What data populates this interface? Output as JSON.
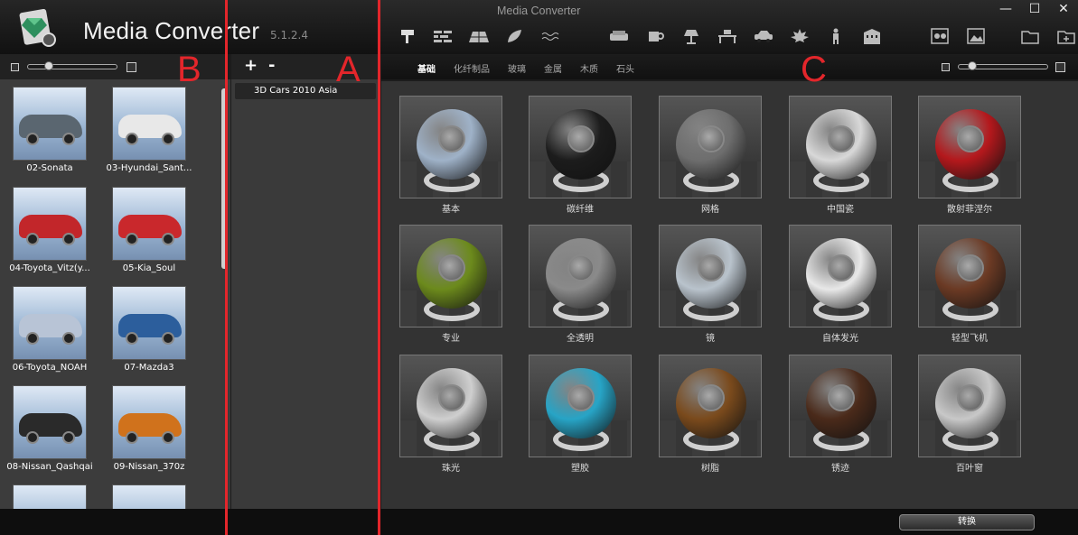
{
  "app": {
    "title": "Media Converter",
    "version": "5.1.2.4",
    "window_title": "Media Converter"
  },
  "window_controls": [
    "—",
    "☐",
    "✕"
  ],
  "annotations": {
    "a": "A",
    "b": "B",
    "c": "C",
    "color": "#e3262b"
  },
  "toolbar": {
    "icons": [
      "paint-roller-icon",
      "bricks-icon",
      "roof-tiles-icon",
      "leaf-icon",
      "water-icon",
      "sofa-icon",
      "cup-icon",
      "lamp-icon",
      "desk-icon",
      "car-icon",
      "maple-leaf-icon",
      "person-icon",
      "building-icon",
      "material-ball-icon",
      "image-icon",
      "folder-icon",
      "add-folder-icon"
    ]
  },
  "panel_a": {
    "add_label": "+",
    "remove_label": "-",
    "libraries": [
      "3D Cars 2010 Asia"
    ]
  },
  "panel_b": {
    "models": [
      {
        "name": "02-Sonata",
        "color": "#5a6670"
      },
      {
        "name": "03-Hyundai_Sant...",
        "color": "#e8e8e8"
      },
      {
        "name": "04-Toyota_Vitz(y...",
        "color": "#c2262a"
      },
      {
        "name": "05-Kia_Soul",
        "color": "#c9282c"
      },
      {
        "name": "06-Toyota_NOAH",
        "color": "#b8c4d6"
      },
      {
        "name": "07-Mazda3",
        "color": "#2c5e9c"
      },
      {
        "name": "08-Nissan_Qashqai",
        "color": "#2a2a2a"
      },
      {
        "name": "09-Nissan_370z",
        "color": "#d0721c"
      },
      {
        "name": "",
        "color": "#9ab5d3"
      },
      {
        "name": "",
        "color": "#9ab5d3"
      }
    ]
  },
  "panel_c": {
    "tabs": [
      "基础",
      "化纤制品",
      "玻璃",
      "金属",
      "木质",
      "石头"
    ],
    "active_tab": 0,
    "materials": [
      {
        "name": "基本",
        "color": "#9fb2c8"
      },
      {
        "name": "碳纤维",
        "color": "#1c1c1c"
      },
      {
        "name": "网格",
        "color": "#6e6e6e"
      },
      {
        "name": "中国瓷",
        "color": "#d8d8d8"
      },
      {
        "name": "散射菲涅尔",
        "color": "#b4181c"
      },
      {
        "name": "专业",
        "color": "#6c8a1c"
      },
      {
        "name": "全透明",
        "color": "#8a8a8a"
      },
      {
        "name": "镜",
        "color": "#b9c3cc"
      },
      {
        "name": "自体发光",
        "color": "#e8e8e8"
      },
      {
        "name": "轻型飞机",
        "color": "#6b3a24"
      },
      {
        "name": "珠光",
        "color": "#cfcfcf"
      },
      {
        "name": "塑胶",
        "color": "#27a4c6"
      },
      {
        "name": "树脂",
        "color": "#7a4a1c"
      },
      {
        "name": "锈迹",
        "color": "#4a2a1a"
      },
      {
        "name": "百叶窗",
        "color": "#c8c8c8"
      }
    ]
  },
  "convert_label": "转换"
}
